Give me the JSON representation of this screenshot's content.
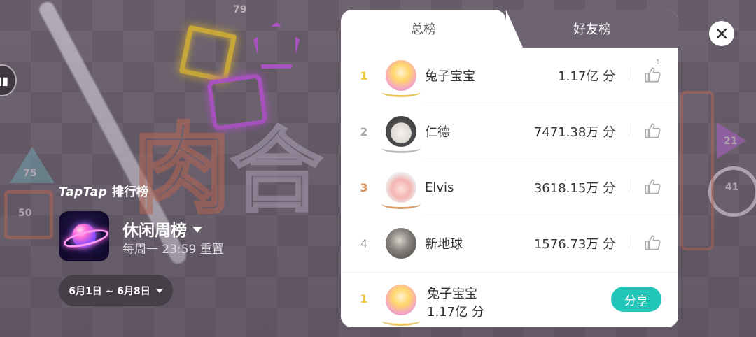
{
  "background": {
    "numbers": [
      "79",
      "75",
      "50",
      "21",
      "41"
    ]
  },
  "left": {
    "side_button_icon": "chat-bubble-icon",
    "brand": {
      "logo_text": "TapTap",
      "suffix": "排行榜"
    },
    "app_icon": "planet-game-icon",
    "board_title": "休闲周榜",
    "reset_text": "每周一 23:59 重置",
    "date_range": "6月1日 ~ 6月8日"
  },
  "leaderboard": {
    "tabs": [
      {
        "label": "总榜",
        "active": true
      },
      {
        "label": "好友榜",
        "active": false
      }
    ],
    "rows": [
      {
        "rank": "1",
        "name": "兔子宝宝",
        "score": "1.17亿 分",
        "likes": "1",
        "avatar_color": "#f4a3c9",
        "laurel_color": "#e8c45a"
      },
      {
        "rank": "2",
        "name": "仁德",
        "score": "7471.38万 分",
        "likes": "",
        "avatar_color": "#d9d9d9",
        "laurel_color": "#b9b9bd"
      },
      {
        "rank": "3",
        "name": "Elvis",
        "score": "3618.15万 分",
        "likes": "",
        "avatar_color": "#f3c6c6",
        "laurel_color": "#d8a06e"
      },
      {
        "rank": "4",
        "name": "新地球",
        "score": "1576.73万 分",
        "likes": "",
        "avatar_color": "#6d6a66",
        "laurel_color": ""
      }
    ],
    "me": {
      "rank": "1",
      "name": "兔子宝宝",
      "score": "1.17亿 分",
      "share_label": "分享"
    }
  },
  "colors": {
    "accent": "#21c6b9",
    "gold": "#f0c83c",
    "silver": "#a9a9ad",
    "bronze": "#d8905a",
    "tab_bar": "#6e6372"
  }
}
